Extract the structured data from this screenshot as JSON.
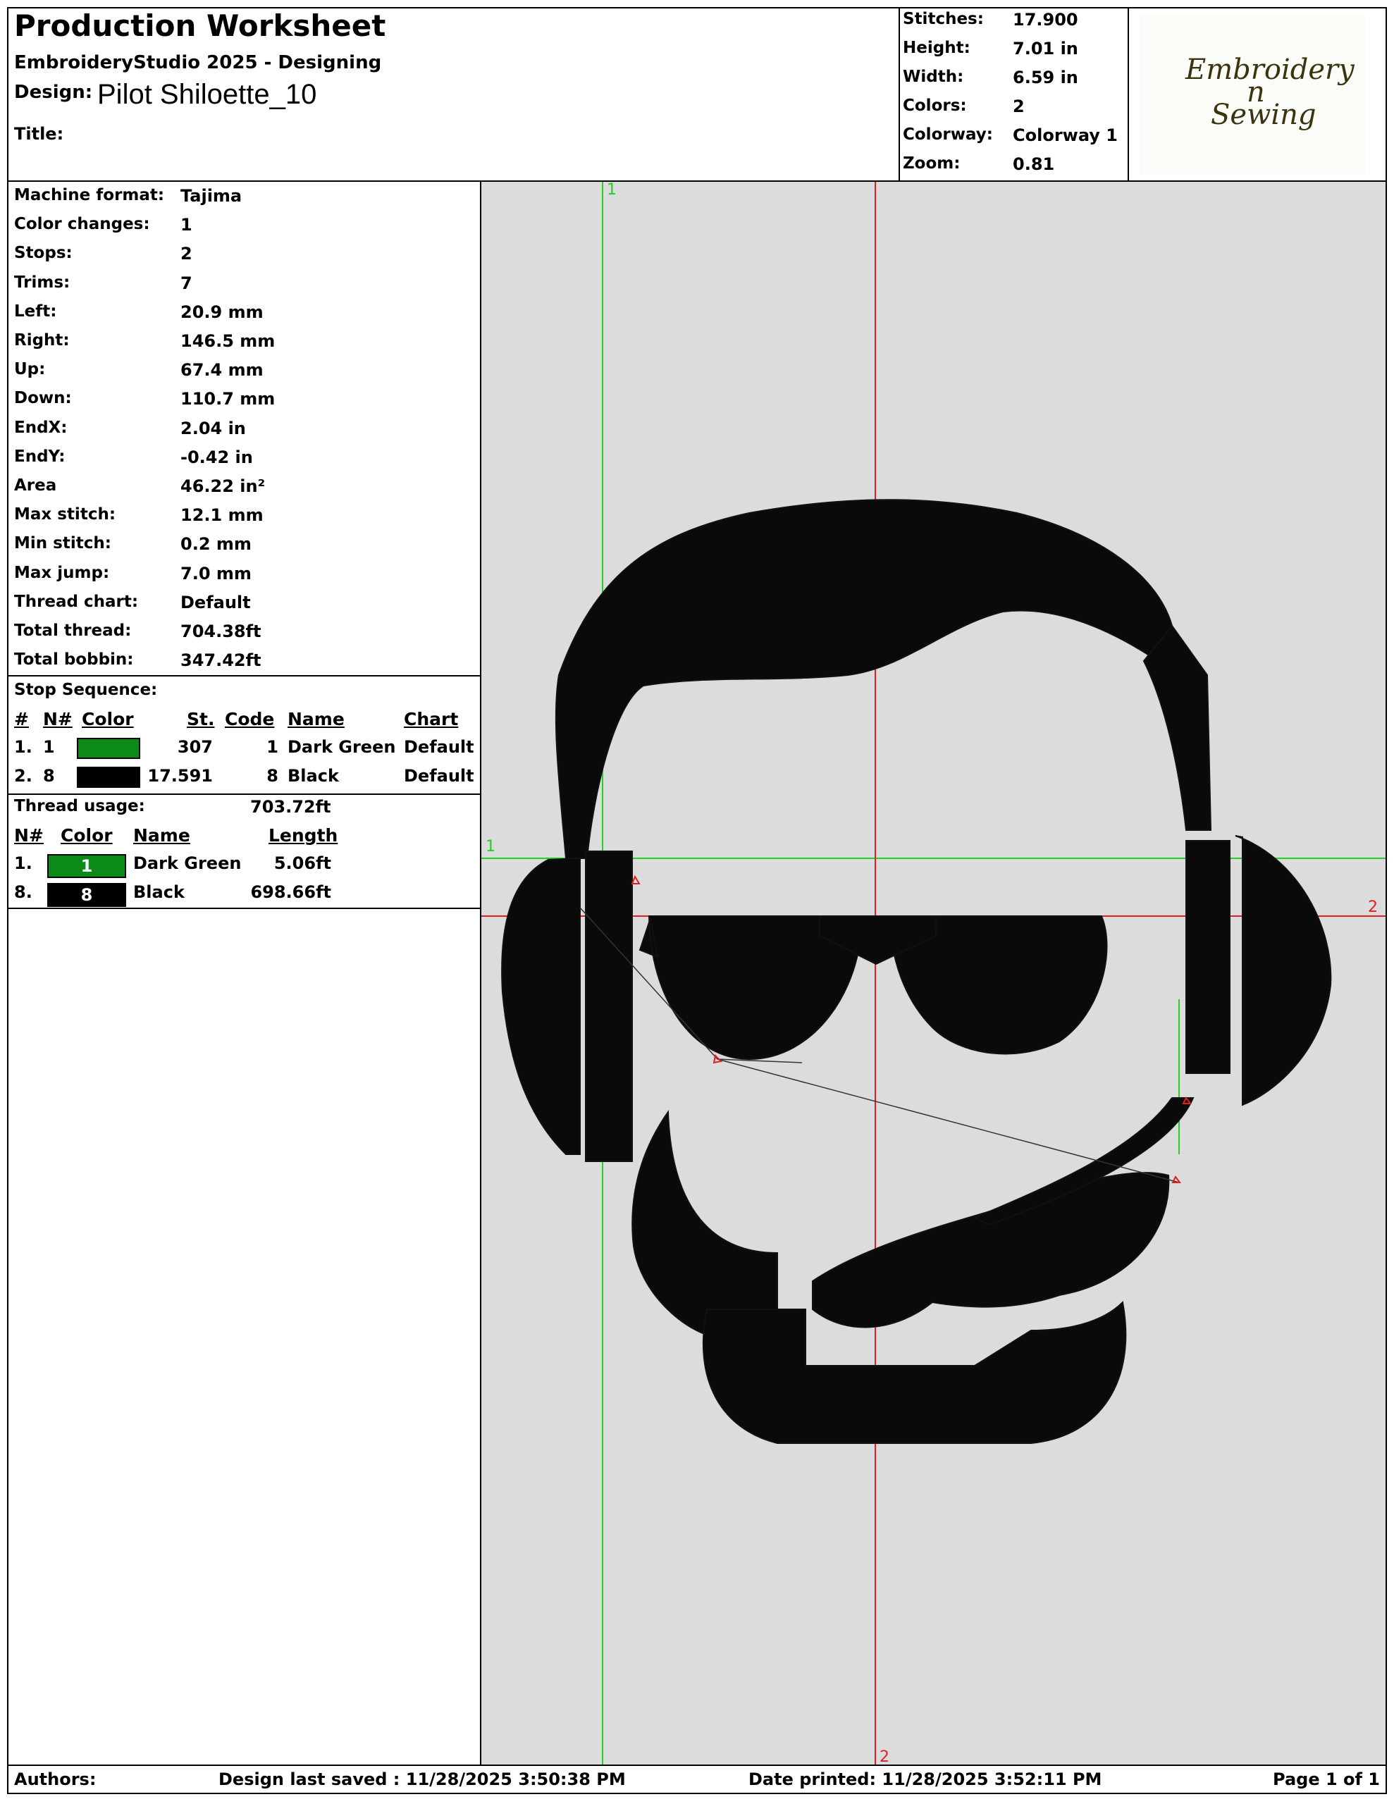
{
  "colors": {
    "dark_green": "#0b8a17",
    "black": "#000000",
    "canvas_bg": "#dcdcdc",
    "guide_green": "#1fd21f",
    "guide_red": "#e02020"
  },
  "header": {
    "title": "Production Worksheet",
    "app": "EmbroideryStudio 2025 - Designing",
    "design_label": "Design:",
    "design_value": "Pilot Shiloette_10",
    "title_label": "Title:"
  },
  "summary": [
    {
      "label": "Stitches:",
      "value": "17.900"
    },
    {
      "label": "Height:",
      "value": "7.01 in"
    },
    {
      "label": "Width:",
      "value": "6.59 in"
    },
    {
      "label": "Colors:",
      "value": "2"
    },
    {
      "label": "Colorway:",
      "value": "Colorway 1"
    },
    {
      "label": "Zoom:",
      "value": "0.81"
    }
  ],
  "logo": {
    "line1": "Embroidery",
    "line2": "n",
    "line3": "Sewing"
  },
  "details": [
    {
      "label": "Machine format:",
      "value": "Tajima"
    },
    {
      "label": "Color changes:",
      "value": "1"
    },
    {
      "label": "Stops:",
      "value": "2"
    },
    {
      "label": "Trims:",
      "value": "7"
    },
    {
      "label": "Left:",
      "value": "20.9 mm"
    },
    {
      "label": "Right:",
      "value": "146.5 mm"
    },
    {
      "label": "Up:",
      "value": "67.4 mm"
    },
    {
      "label": "Down:",
      "value": "110.7 mm"
    },
    {
      "label": "EndX:",
      "value": "2.04 in"
    },
    {
      "label": "EndY:",
      "value": "-0.42 in"
    },
    {
      "label": "Area",
      "value": " 46.22 in²"
    },
    {
      "label": "Max stitch:",
      "value": "12.1 mm"
    },
    {
      "label": "Min stitch:",
      "value": "0.2 mm"
    },
    {
      "label": "Max jump:",
      "value": "7.0 mm"
    },
    {
      "label": "Thread chart:",
      "value": "Default"
    },
    {
      "label": "Total thread:",
      "value": "704.38ft"
    },
    {
      "label": "Total bobbin:",
      "value": "347.42ft"
    }
  ],
  "stop_sequence": {
    "title": "Stop Sequence:",
    "headers": {
      "num": "#",
      "n": "N#",
      "color": "Color",
      "st": "St.",
      "code": "Code",
      "name": "Name",
      "chart": "Chart"
    },
    "rows": [
      {
        "num": "1.",
        "n": "1",
        "color": "#0b8a17",
        "st": "307",
        "code": "1",
        "name": "Dark Green",
        "chart": "Default"
      },
      {
        "num": "2.",
        "n": "8",
        "color": "#000000",
        "st": "17.591",
        "code": "8",
        "name": "Black",
        "chart": "Default"
      }
    ]
  },
  "thread_usage": {
    "title": "Thread usage:",
    "total": "703.72ft",
    "headers": {
      "n": "N#",
      "color": "Color",
      "name": "Name",
      "length": "Length"
    },
    "rows": [
      {
        "n": "1.",
        "swatch": "1",
        "color": "#0b8a17",
        "name": "Dark Green",
        "length": "5.06ft"
      },
      {
        "n": "8.",
        "swatch": "8",
        "color": "#000000",
        "name": "Black",
        "length": "698.66ft"
      }
    ]
  },
  "canvas": {
    "guide_v1": "1",
    "guide_h1": "1",
    "guide_v2": "2",
    "guide_h2": "2"
  },
  "footer": {
    "authors": "Authors:",
    "saved": "Design last saved : 11/28/2025 3:50:38 PM",
    "printed": "Date printed: 11/28/2025 3:52:11 PM",
    "page": "Page 1 of 1"
  }
}
